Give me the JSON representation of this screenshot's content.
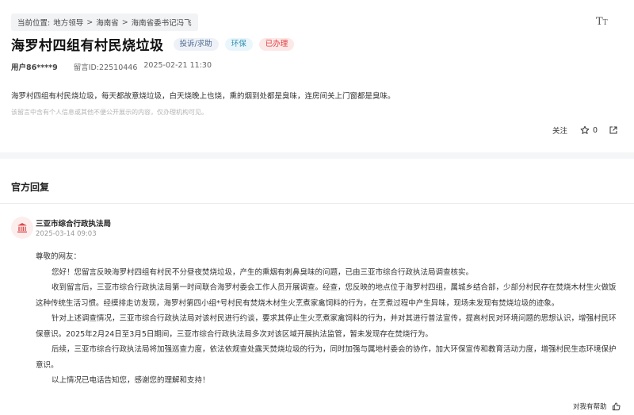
{
  "breadcrumb": {
    "label": "当前位置:",
    "items": [
      "地方领导",
      "海南省",
      "海南省委书记冯飞"
    ],
    "separator": ">"
  },
  "font_toggle": {
    "big": "T",
    "small": "T"
  },
  "message": {
    "title": "海罗村四组有村民烧垃圾",
    "tags": {
      "type": "投诉/求助",
      "field": "环保",
      "status": "已办理"
    },
    "user": "用户86****9",
    "message_id": "留言ID:22510446",
    "time": "2025-02-21 11:30",
    "content": "海罗村四组有村民烧垃圾，每天都故意烧垃圾，白天烧晚上也烧，熏的烟到处都是臭味，连房间关上门窗都是臭味。",
    "notice": "该留言中含有个人信息或其他不便公开展示的内容，仅办理机构可见。"
  },
  "actions": {
    "follow": "关注",
    "like_count": "0"
  },
  "official_reply": {
    "section_title": "官方回复",
    "department": "三亚市综合行政执法局",
    "time": "2025-03-14 09:03",
    "greeting": "尊敬的网友：",
    "paragraphs": [
      "您好！您留言反映海罗村四组有村民不分昼夜焚烧垃圾，产生的熏烟有刺鼻臭味的问题，已由三亚市综合行政执法局调查核实。",
      "收到留言后，三亚市综合行政执法局第一时间联合海罗村委会工作人员开展调查。经查，您反映的地点位于海罗村四组，属城乡结合部，少部分村民存在焚烧木材生火做饭这种传统生活习惯。经摸排走访发现，海罗村第四小组*号村民有焚烧木材生火烹煮家禽饲料的行为，在烹煮过程中产生异味，现场未发现有焚烧垃圾的迹象。",
      "针对上述调查情况，三亚市综合行政执法局对该村民进行约谈，要求其停止生火烹煮家禽饲料的行为，并对其进行普法宣传，提高村民对环境问题的思想认识，增强村民环保意识。2025年2月24日至3月5日期间，三亚市综合行政执法局多次对该区域开展执法监管，暂未发现存在焚烧行为。",
      "后续，三亚市综合行政执法局将加强巡查力度，依法依规查处露天焚烧垃圾的行为，同时加强与属地村委会的协作，加大环保宣传和教育活动力度，增强村民生态环境保护意识。",
      "以上情况已电话告知您，感谢您的理解和支持！"
    ]
  },
  "helpful": {
    "label": "对我有帮助"
  }
}
